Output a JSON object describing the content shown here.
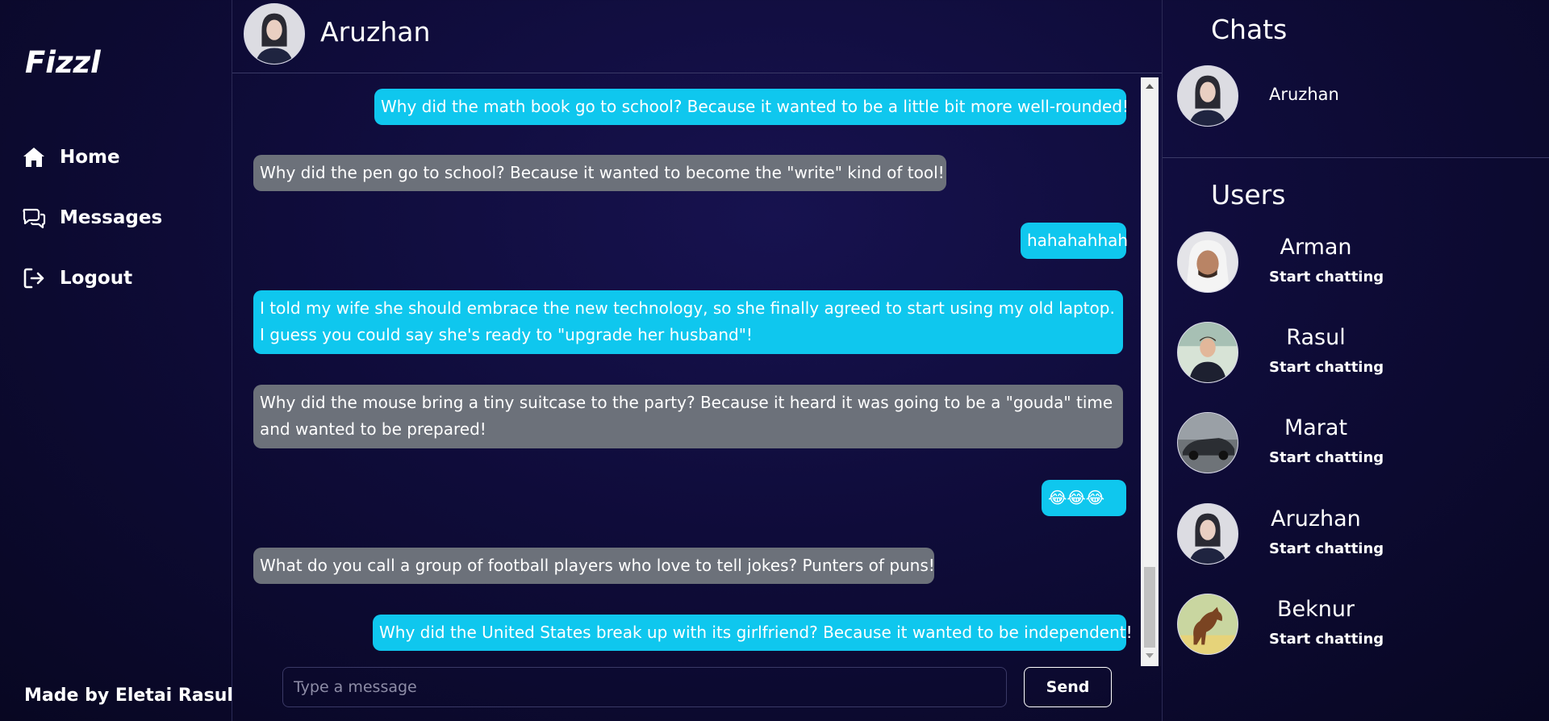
{
  "app": {
    "logo": "Fizzl",
    "footer": "Made by Eletai Rasul"
  },
  "nav": [
    {
      "label": "Home",
      "icon": "home-icon"
    },
    {
      "label": "Messages",
      "icon": "messages-icon"
    },
    {
      "label": "Logout",
      "icon": "logout-icon"
    }
  ],
  "conversation": {
    "name": "Aruzhan",
    "messages": [
      {
        "side": "out",
        "text": "Why did the math book go to school? Because it wanted to be a little bit more well-rounded!"
      },
      {
        "side": "in",
        "text": "Why did the pen go to school? Because it wanted to become the \"write\" kind of tool!"
      },
      {
        "side": "out",
        "text": "hahahahhah"
      },
      {
        "side": "out",
        "text": "I told my wife she should embrace the new technology, so she finally agreed to start using my old laptop. I guess you could say she's ready to \"upgrade her husband\"!"
      },
      {
        "side": "in",
        "text": "Why did the mouse bring a tiny suitcase to the party? Because it heard it was going to be a \"gouda\" time and wanted to be prepared!"
      },
      {
        "side": "out",
        "text": "😂😂😂"
      },
      {
        "side": "in",
        "text": "What do you call a group of football players who love to tell jokes? Punters of puns!"
      },
      {
        "side": "out",
        "text": "Why did the United States break up with its girlfriend? Because it wanted to be independent!"
      }
    ],
    "input_placeholder": "Type a message",
    "send_label": "Send"
  },
  "chats": {
    "title": "Chats",
    "items": [
      {
        "name": "Aruzhan"
      }
    ]
  },
  "users": {
    "title": "Users",
    "items": [
      {
        "name": "Arman",
        "action": "Start chatting"
      },
      {
        "name": "Rasul",
        "action": "Start chatting"
      },
      {
        "name": "Marat",
        "action": "Start chatting"
      },
      {
        "name": "Aruzhan",
        "action": "Start chatting"
      },
      {
        "name": "Beknur",
        "action": "Start chatting"
      }
    ]
  },
  "colors": {
    "outgoing": "#0fc7ee",
    "incoming": "#6c717a",
    "background": "#0f0c3a"
  }
}
